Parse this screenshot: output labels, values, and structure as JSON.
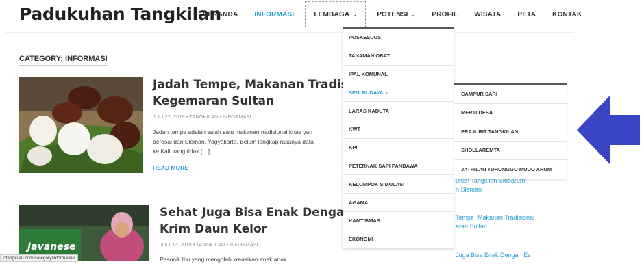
{
  "site": {
    "title": "Padukuhan Tangkilan"
  },
  "nav": {
    "items": [
      {
        "label": "BERANDA",
        "has_dropdown": false
      },
      {
        "label": "INFORMASI",
        "has_dropdown": false,
        "active": true
      },
      {
        "label": "LEMBAGA",
        "has_dropdown": true
      },
      {
        "label": "POTENSI",
        "has_dropdown": true
      },
      {
        "label": "PROFIL",
        "has_dropdown": false
      },
      {
        "label": "WISATA",
        "has_dropdown": false
      },
      {
        "label": "PETA",
        "has_dropdown": false
      },
      {
        "label": "KONTAK",
        "has_dropdown": false
      }
    ]
  },
  "page": {
    "category_label": "CATEGORY: INFORMASI"
  },
  "posts": [
    {
      "title_line1": "Jadah Tempe, Makanan Tradision",
      "title_line2": "Kegemaran Sultan",
      "meta": "JULI 22, 2018  •  TANGKILAN  •  INFORMASI",
      "excerpt_line1": "Jadah tempe adalah salah satu makanan tradisional khas yan",
      "excerpt_line2": "berasal dari Sleman, Yogyakarta. Belum lengkap rasanya data",
      "excerpt_line3": "ke Kaliurang tidak […]",
      "read_more": "READ MORE"
    },
    {
      "title_line1": "Sehat Juga Bisa Enak Dengan Es",
      "title_line2": "Krim Daun Kelor",
      "meta": "JULI 22, 2018  •  TANGKILAN  •  INFORMASI",
      "excerpt_line1": "Pesonik Ibu yang mengolah kreasikan anak anak"
    }
  ],
  "dropdown": {
    "items": [
      {
        "label": "POSKESDUS"
      },
      {
        "label": "TANAMAN OBAT"
      },
      {
        "label": "IPAL KOMUNAL"
      },
      {
        "label": "SENI BUDAYA",
        "active": true,
        "has_submenu": true
      },
      {
        "label": "LARAS KADUTA"
      },
      {
        "label": "KWT"
      },
      {
        "label": "KPI"
      },
      {
        "label": "PETERNAK SAPI PANDAWA"
      },
      {
        "label": "KELOMPOK SIMULASI"
      },
      {
        "label": "AGAMA"
      },
      {
        "label": "KAMTIBMAS"
      },
      {
        "label": "EKONOMI"
      }
    ]
  },
  "submenu": {
    "items": [
      {
        "label": "CAMPUR SARI"
      },
      {
        "label": "MERTI DESA"
      },
      {
        "label": "PRAJURIT TANGKILAN"
      },
      {
        "label": "SHOLLAREMTA"
      },
      {
        "label": "JATHILAN TURONGGO MUDO ARUM"
      }
    ]
  },
  "sidebar": {
    "links": [
      {
        "line1": "unan Tangkilan Sidoarum",
        "line2": "n Sleman"
      },
      {
        "line1": "Tempe, Makanan Tradisional",
        "line2": "aran Sultan"
      },
      {
        "line1": "Juga Bisa Enak Dengan Es",
        "line2": ""
      }
    ]
  },
  "thumb2_text": {
    "sign": "Javanese"
  },
  "status_bar": {
    "url": "//tangkilan.com/category/informasi/#"
  },
  "colors": {
    "accent": "#2a9fd6",
    "arrow": "#3b45c4"
  },
  "chevron_glyph": "⌄",
  "arrow_glyph": "›"
}
